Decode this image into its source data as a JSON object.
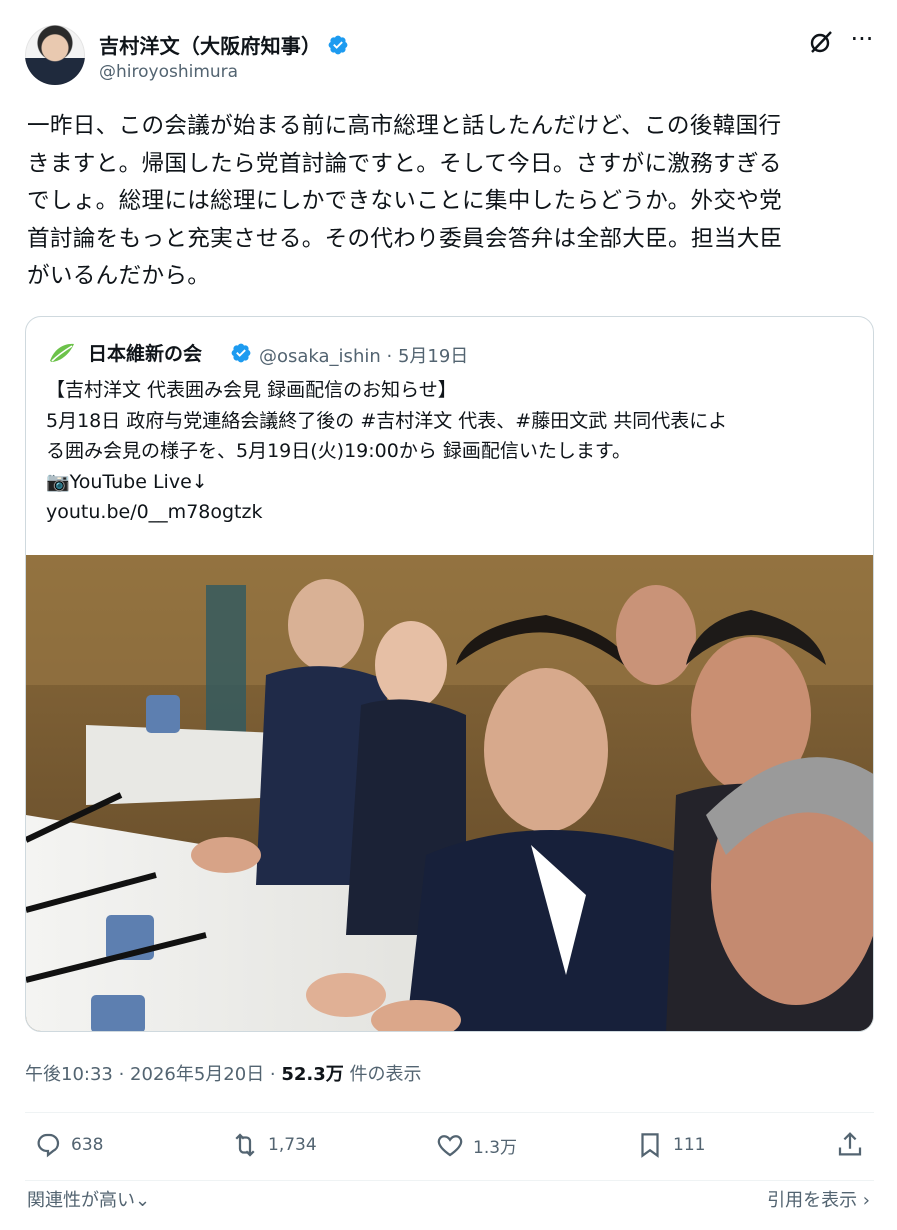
{
  "author": {
    "display_name": "吉村洋文（大阪府知事）",
    "handle": "@hiroyoshimura",
    "verified": true
  },
  "icons": {
    "avatar": "profile-photo",
    "verified": "verified-badge-icon",
    "grok": "grok-icon",
    "more": "more-icon"
  },
  "tweet": {
    "text": "一昨日、この会議が始まる前に高市総理と話したんだけど、この後韓国行\nきますと。帰国したら党首討論ですと。そして今日。さすがに激務すぎる\nでしょ。総理には総理にしかできないことに集中したらどうか。外交や党\n首討論をもっと充実させる。その代わり委員会答弁は全部大臣。担当大臣\nがいるんだから。"
  },
  "quote": {
    "name": "日本維新の会",
    "handle": "@osaka_ishin",
    "date": "· 5月19日",
    "text": "【吉村洋文 代表囲み会見 録画配信のお知らせ】\n 5月18日 政府与党連絡会議終了後の #吉村洋文 代表、#藤田文武 共同代表によ\nる囲み会見の様子を、5月19日(火)19:00から 録画配信いたします。\n📷YouTube Live↓",
    "link": "youtu.be/0__m78ogtzk"
  },
  "meta": {
    "time": "午後10:33 · 2026年5月20日 · ",
    "views": "52.3万",
    "views_suffix": " 件の表示"
  },
  "actions": {
    "replies": "638",
    "reposts": "1,734",
    "likes": "1.3万",
    "bookmarks": "111"
  },
  "footer": {
    "left": "関連性が高い⌄",
    "right": "引用を表示 ›"
  },
  "colors": {
    "accent": "#1d9bf0",
    "muted": "#536471",
    "border": "#cfd9de",
    "ishin_green": "#6cc24a"
  }
}
